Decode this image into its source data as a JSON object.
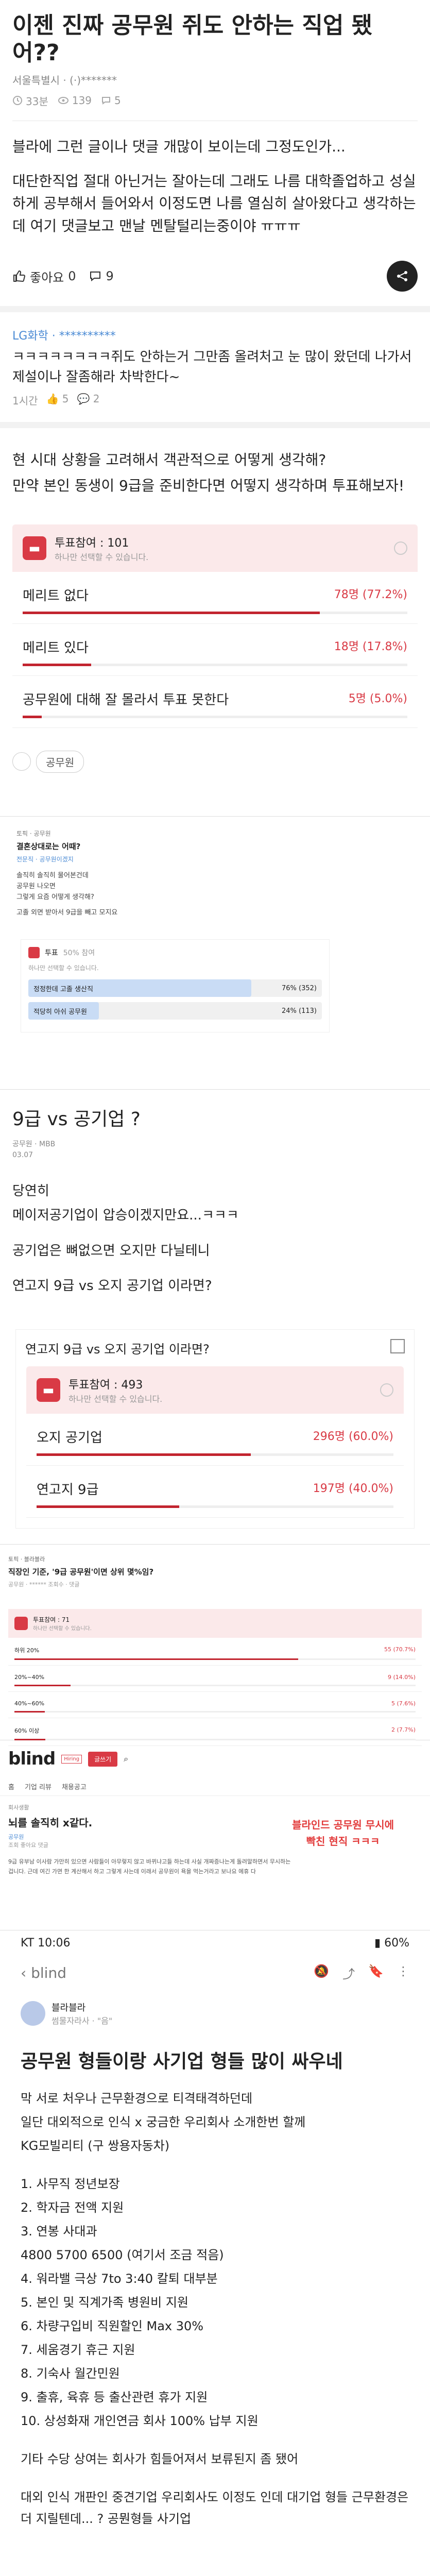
{
  "post1": {
    "title": "이젠 진짜 공무원 쥐도 안하는 직업 됐어??",
    "board_line": "서울특별시 · (·)*******",
    "time": "33분",
    "views": "139",
    "comments_count": "5",
    "body": [
      "블라에 그런 글이나 댓글 개많이 보이는데 그정도인가...",
      "대단한직업 절대 아닌거는 잘아는데 그래도 나름 대학졸업하고 성실하게 공부해서 들어와서 이정도면 나름 열심히 살아왔다고 생각하는데 여기 댓글보고 맨날 멘탈털리는중이야 ㅠㅠㅠ"
    ],
    "like_label": "좋아요",
    "like_count": "0",
    "comment_count_icon": "9"
  },
  "comment1": {
    "author": "LG화학 · **********",
    "text": "ㅋㅋㅋㅋㅋㅋㅋㅋ쥐도 안하는거 그만좀 올려처고 눈 많이 왔던데 나가서 제설이나 잘좀해라 차박한다~",
    "time": "1시간",
    "likes": "5",
    "replies": "2"
  },
  "post_body2": [
    "현 시대 상황을 고려해서 객관적으로 어떻게 생각해?",
    "만약 본인 동생이 9급을 준비한다면 어떻지 생각하며 투표해보자!"
  ],
  "poll1": {
    "participants_label": "투표참여 : 101",
    "sub": "하나만 선택할 수 있습니다.",
    "options": [
      {
        "label": "메리트 없다",
        "result": "78명 (77.2%)",
        "frac": 0.772
      },
      {
        "label": "메리트 있다",
        "result": "18명 (17.8%)",
        "frac": 0.178
      },
      {
        "label": "공무원에 대해 잘 몰라서 투표 못한다",
        "result": "5명 (5.0%)",
        "frac": 0.05
      }
    ]
  },
  "tag1": "공무원",
  "exam_post": {
    "category": "토픽 · 공무원",
    "title": "결혼상대로는 어때?",
    "meta": "전문직 · 공무원이겠지",
    "body": [
      "솔직히 솔직히 물어본건데",
      "공무원 나오면",
      "그렇게 요즘 어떻게 생각해?",
      "",
      "고졸 외면 받아서 9급을 빼고 모지요"
    ],
    "poll_head": "투표",
    "poll_count": "50% 참여",
    "poll_sub": "하나만 선택할 수 있습니다.",
    "options": [
      {
        "label": "정정한데 고졸 생산직",
        "result": "76% (352)",
        "frac": 0.76
      },
      {
        "label": "적당히 아쉬 공무원",
        "result": "24% (113)",
        "frac": 0.24
      }
    ]
  },
  "q_post": {
    "title": "9급 vs 공기업 ?",
    "meta1": "공무원 · MBB",
    "meta2": "03.07",
    "body": [
      "당연히",
      "메이저공기업이 압승이겠지만요...ㅋㅋㅋ",
      "공기업은 뼈없으면 오지만 다닐테니",
      "연고지 9급 vs 오지 공기업 이라면?"
    ],
    "poll_title": "연고지 9급 vs 오지 공기업 이라면?",
    "participants_label": "투표참여 : 493",
    "sub": "하나만 선택할 수 있습니다.",
    "options": [
      {
        "label": "오지 공기업",
        "result": "296명 (60.0%)",
        "frac": 0.6
      },
      {
        "label": "연고지 9급",
        "result": "197명 (40.0%)",
        "frac": 0.4
      }
    ]
  },
  "job_post": {
    "category": "토픽 · 블라블라",
    "title": "직장인 기준, '9급 공무원'이면 상위 몇%임?",
    "meta": "공무원 · ****** 조회수 · 댓글",
    "poll_count": "투표참여 : 71",
    "poll_sub": "하나만 선택할 수 있습니다.",
    "options": [
      {
        "label": "하위 20%",
        "result": "55 (70.7%)",
        "frac": 0.707
      },
      {
        "label": "20%~40%",
        "result": "9 (14.0%)",
        "frac": 0.14
      },
      {
        "label": "40%~60%",
        "result": "5 (7.6%)",
        "frac": 0.076
      },
      {
        "label": "60% 이상",
        "result": "2 (7.7%)",
        "frac": 0.077
      }
    ]
  },
  "blind": {
    "logo": "blind",
    "tag": "Hiring",
    "write_button": "글쓰기",
    "nav": [
      "홈",
      "기업 리뷰",
      "채용공고"
    ],
    "category": "회사생활",
    "title": "뇌를 솔직히 x같다.",
    "author": "공무원",
    "meta": "조회 좋아요 댓글",
    "body": "9급 유부남 이사람 가만히 있으면 사람들이 아무렇지 않고 바뀌냐고들 하는데 사실 개짜증나는게 돌려말하면서 무시하는 겁니다. 근데 여긴 가면 한 계산해서 하고 그렇게 사는데 이래서 공무원이 욕을 먹는거라고 보나요 에휴 다",
    "overlay": [
      "블라인드 공무원 무시에",
      "빡친 현직 ㅋㅋㅋ"
    ]
  },
  "phone": {
    "time": "KT 10:06",
    "status_right": "60%",
    "app": "blind",
    "author": "블라블라",
    "author_sub": "썸물자라사 · \"음\"",
    "title": "공무원 형들이랑 사기업 형들 많이 싸우네",
    "body": [
      "막 서로 처우나 근무환경으로 티격태격하던데",
      "일단 대외적으로 인식 x 궁금한 우리회사 소개한번 할께",
      "KG모빌리티 (구 쌍용자동차)",
      "",
      "1. 사무직 정년보장",
      "2. 학자금 전액 지원",
      "3. 연봉 사대과",
      "   4800 5700 6500 (여기서 조금 적음)",
      "4. 워라밸 극상 7to 3:40 칼퇴 대부분",
      "5. 본인 및 직계가족 병원비 지원",
      "6. 차량구입비 직원할인 Max 30%",
      "7. 세움경기 휴근 지원",
      "8. 기숙사 월간민원",
      "9. 출휴, 육휴 등 출산관련 휴가 지원",
      "10. 상성화재 개인연금 회사 100% 납부 지원",
      "",
      "기타 수당 상여는 회사가 힘들어져서 보류된지 좀 됐어",
      "",
      "대외 인식 개판인 중견기업 우리회사도 이정도 인데 대기업 형들 근무환경은 더 지릴텐데... ? 공뭔형들 사기업"
    ]
  }
}
